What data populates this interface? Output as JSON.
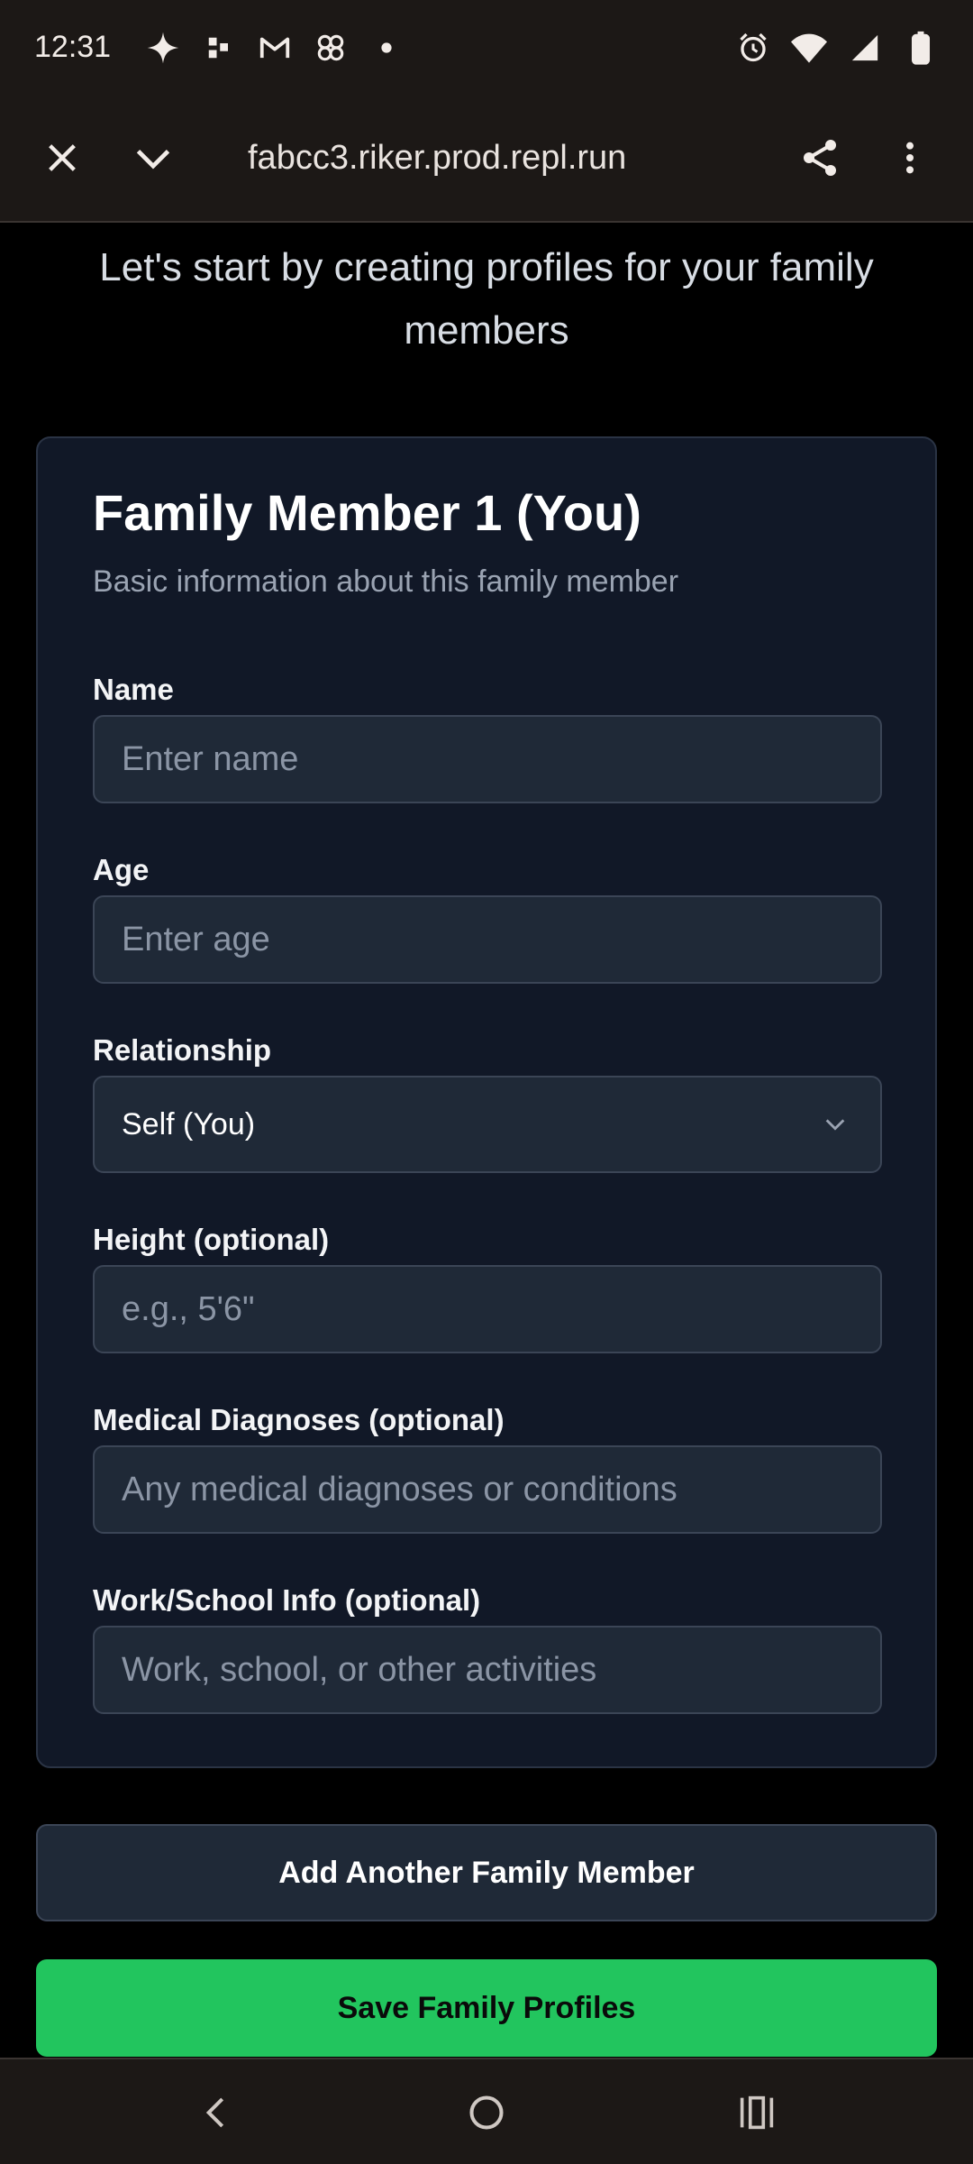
{
  "status_bar": {
    "time": "12:31",
    "left_icons": [
      "sparkle-icon",
      "dots-app-icon",
      "gmail-icon",
      "pinwheel-icon",
      "notification-dot-icon"
    ],
    "right_icons": [
      "alarm-icon",
      "wifi-icon",
      "signal-icon",
      "battery-icon"
    ]
  },
  "browser": {
    "url": "fabcc3.riker.prod.repl.run",
    "icons": [
      "close-icon",
      "chevron-down-icon",
      "share-icon",
      "more-vert-icon"
    ]
  },
  "page": {
    "intro": "Let's start by creating profiles for your family members"
  },
  "card": {
    "title": "Family Member 1 (You)",
    "subtitle": "Basic information about this family member",
    "fields": {
      "name": {
        "label": "Name",
        "placeholder": "Enter name",
        "value": ""
      },
      "age": {
        "label": "Age",
        "placeholder": "Enter age",
        "value": ""
      },
      "relationship": {
        "label": "Relationship",
        "value": "Self (You)"
      },
      "height": {
        "label": "Height (optional)",
        "placeholder": "e.g., 5'6\"",
        "value": ""
      },
      "medical": {
        "label": "Medical Diagnoses (optional)",
        "placeholder": "Any medical diagnoses or conditions",
        "value": ""
      },
      "work": {
        "label": "Work/School Info (optional)",
        "placeholder": "Work, school, or other activities",
        "value": ""
      }
    }
  },
  "actions": {
    "add_member": "Add Another Family Member",
    "save": "Save Family Profiles"
  },
  "colors": {
    "primary_button": "#22c55e",
    "card_bg": "#111827",
    "input_bg": "#1f2937"
  }
}
